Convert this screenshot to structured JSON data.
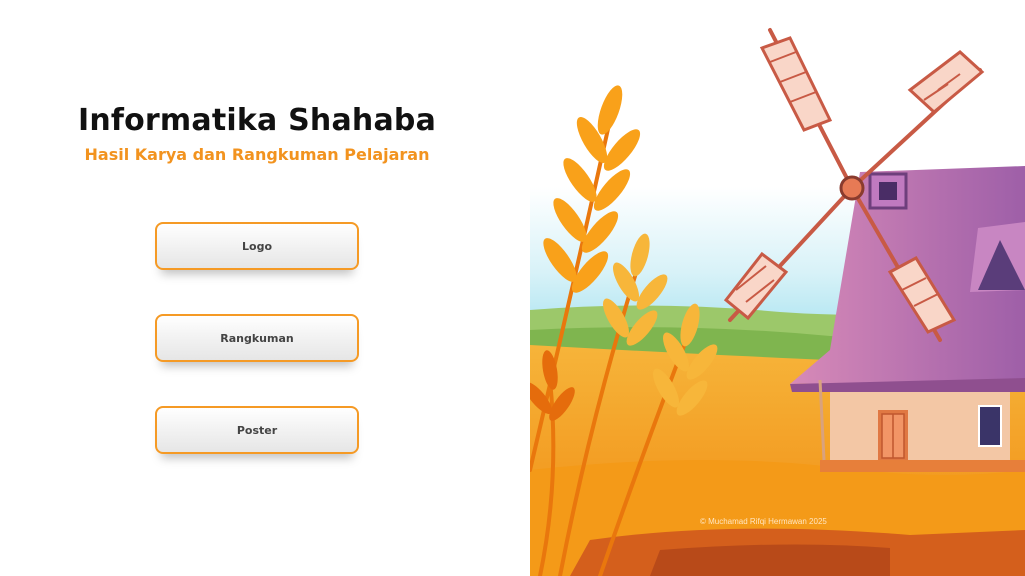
{
  "header": {
    "title": "Informatika Shahaba",
    "subtitle": "Hasil Karya dan Rangkuman Pelajaran"
  },
  "menu": {
    "buttons": [
      {
        "label": "Logo"
      },
      {
        "label": "Rangkuman"
      },
      {
        "label": "Poster"
      }
    ]
  },
  "illustration": {
    "credit": "© Muchamad Rifqi Hermawan 2025",
    "colors": {
      "sky": "#bfe9f4",
      "field": "#f7a21c",
      "wheat": "#f58c12",
      "roof": "#b77ab3",
      "wall": "#f3c7a5",
      "blade": "#c85a45"
    }
  }
}
